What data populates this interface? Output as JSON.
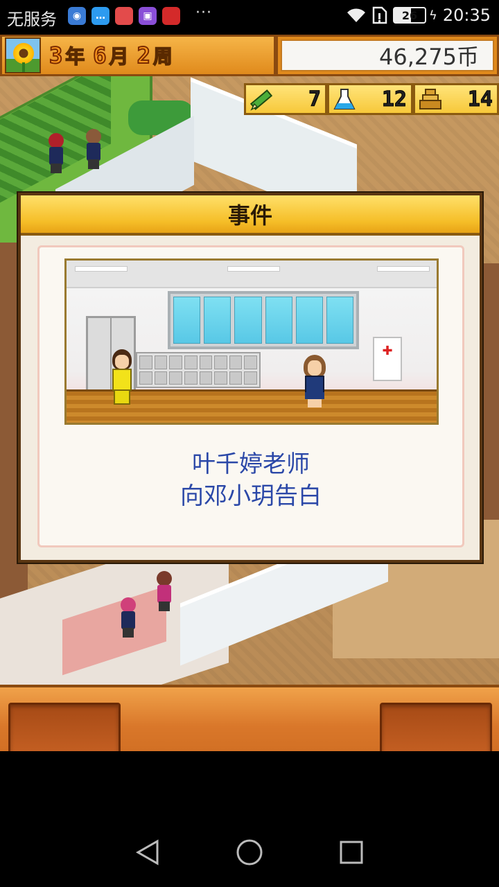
{
  "status_bar": {
    "carrier": "无服务",
    "battery": "26",
    "time": "20:35",
    "more": "···",
    "notif_icons": [
      {
        "name": "app-icon-1",
        "color": "#3a7bd5",
        "glyph": "●"
      },
      {
        "name": "app-icon-2",
        "color": "#2d9bf0",
        "glyph": "…"
      },
      {
        "name": "app-icon-3",
        "color": "#e34b4b",
        "glyph": "字"
      },
      {
        "name": "app-icon-4",
        "color": "#8a4fd8",
        "glyph": "▣"
      },
      {
        "name": "app-icon-5",
        "color": "#d42a2a",
        "glyph": "有"
      }
    ]
  },
  "hud": {
    "year": "3",
    "year_unit": "年",
    "month": "6",
    "month_unit": "月",
    "week": "2",
    "week_unit": "周",
    "money": "46,275币",
    "stats": [
      {
        "icon": "pencil-icon",
        "value": "7"
      },
      {
        "icon": "flask-icon",
        "value": "12"
      },
      {
        "icon": "trophy-icon",
        "value": "14"
      }
    ]
  },
  "dialog": {
    "title": "事件",
    "message_line1": "叶千婷老师",
    "message_line2": "向邓小玥告白"
  },
  "colors": {
    "accent_orange": "#e08a1c",
    "message_blue": "#2b48a8",
    "header_yellow": "#f5be28"
  }
}
